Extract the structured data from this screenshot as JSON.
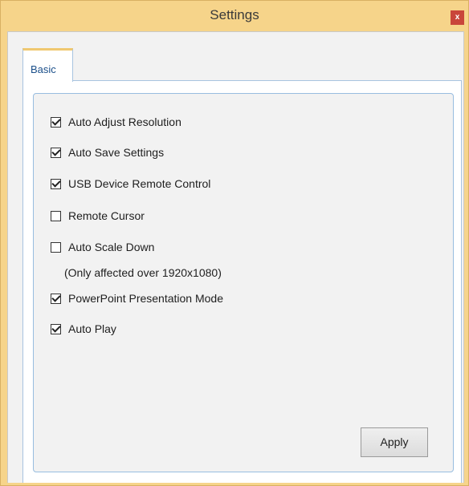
{
  "window": {
    "title": "Settings",
    "close_label": "x"
  },
  "tabs": [
    {
      "label": "Basic",
      "selected": true
    }
  ],
  "options": [
    {
      "label": "Auto Adjust Resolution",
      "checked": true
    },
    {
      "label": "Auto Save Settings",
      "checked": true
    },
    {
      "label": "USB Device Remote Control",
      "checked": true
    },
    {
      "label": "Remote Cursor",
      "checked": false
    },
    {
      "label": "Auto Scale Down",
      "checked": false
    },
    {
      "label": "PowerPoint Presentation Mode",
      "checked": true
    },
    {
      "label": "Auto Play",
      "checked": true
    }
  ],
  "auto_scale_note": "(Only affected over 1920x1080)",
  "apply_label": "Apply"
}
